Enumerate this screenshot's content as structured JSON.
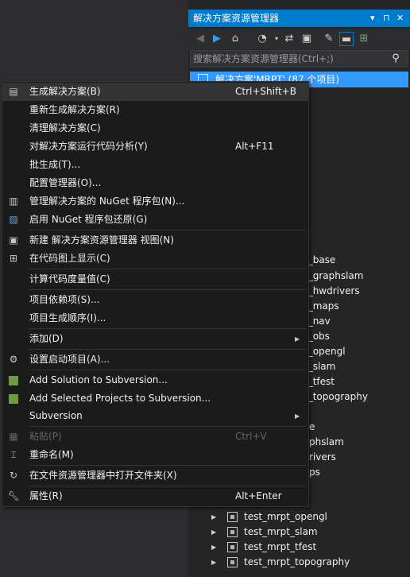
{
  "solution_explorer": {
    "title": "解决方案资源管理器",
    "title_controls": [
      "▾",
      "⊓",
      "✕"
    ],
    "search_placeholder": "搜索解决方案资源管理器(Ctrl+;)",
    "root_label": "解决方案'MRPT' (87 个项目)",
    "tree_partial": [
      "t_base",
      "t_graphslam",
      "t_hwdrivers",
      "t_maps",
      "t_nav",
      "t_obs",
      "t_opengl",
      "t_slam",
      "t_tfest",
      "t_topography",
      "e",
      "phslam",
      "rivers",
      "ps"
    ],
    "tree_items": [
      "test_mrpt_opengl",
      "test_mrpt_slam",
      "test_mrpt_tfest",
      "test_mrpt_topography"
    ]
  },
  "context_menu": {
    "items": [
      {
        "label": "生成解决方案(B)",
        "shortcut": "Ctrl+Shift+B",
        "icon": "build-icon"
      },
      {
        "label": "重新生成解决方案(R)",
        "shortcut": "",
        "icon": ""
      },
      {
        "label": "清理解决方案(C)",
        "shortcut": "",
        "icon": ""
      },
      {
        "label": "对解决方案运行代码分析(Y)",
        "shortcut": "Alt+F11",
        "icon": ""
      },
      {
        "label": "批生成(T)...",
        "shortcut": "",
        "icon": ""
      },
      {
        "label": "配置管理器(O)...",
        "shortcut": "",
        "icon": ""
      },
      {
        "label": "管理解决方案的 NuGet 程序包(N)...",
        "shortcut": "",
        "icon": "nuget-icon"
      },
      {
        "label": "启用 NuGet 程序包还原(G)",
        "shortcut": "",
        "icon": "nuget-restore-icon"
      },
      {
        "label": "新建 解决方案资源管理器 视图(N)",
        "shortcut": "",
        "icon": "new-view-icon"
      },
      {
        "label": "在代码图上显示(C)",
        "shortcut": "",
        "icon": "code-map-icon"
      },
      {
        "label": "计算代码度量值(C)",
        "shortcut": "",
        "icon": ""
      },
      {
        "label": "项目依赖项(S)...",
        "shortcut": "",
        "icon": ""
      },
      {
        "label": "项目生成顺序(I)...",
        "shortcut": "",
        "icon": ""
      },
      {
        "label": "添加(D)",
        "shortcut": "",
        "icon": ""
      },
      {
        "label": "设置启动项目(A)...",
        "shortcut": "",
        "icon": "gear-icon"
      },
      {
        "label": "Add Solution to Subversion...",
        "shortcut": "",
        "icon": "svn-add-icon"
      },
      {
        "label": "Add Selected Projects to Subversion...",
        "shortcut": "",
        "icon": "svn-add-icon"
      },
      {
        "label": "Subversion",
        "shortcut": "",
        "icon": ""
      },
      {
        "label": "粘贴(P)",
        "shortcut": "Ctrl+V",
        "icon": "paste-icon"
      },
      {
        "label": "重命名(M)",
        "shortcut": "",
        "icon": "rename-icon"
      },
      {
        "label": "在文件资源管理器中打开文件夹(X)",
        "shortcut": "",
        "icon": "refresh-icon"
      },
      {
        "label": "属性(R)",
        "shortcut": "Alt+Enter",
        "icon": "wrench-icon"
      }
    ]
  },
  "colors": {
    "accent": "#007acc",
    "selection": "#3399ff",
    "menu_bg": "#1b1b1c",
    "panel_bg": "#252526",
    "app_bg": "#2d2d30"
  }
}
